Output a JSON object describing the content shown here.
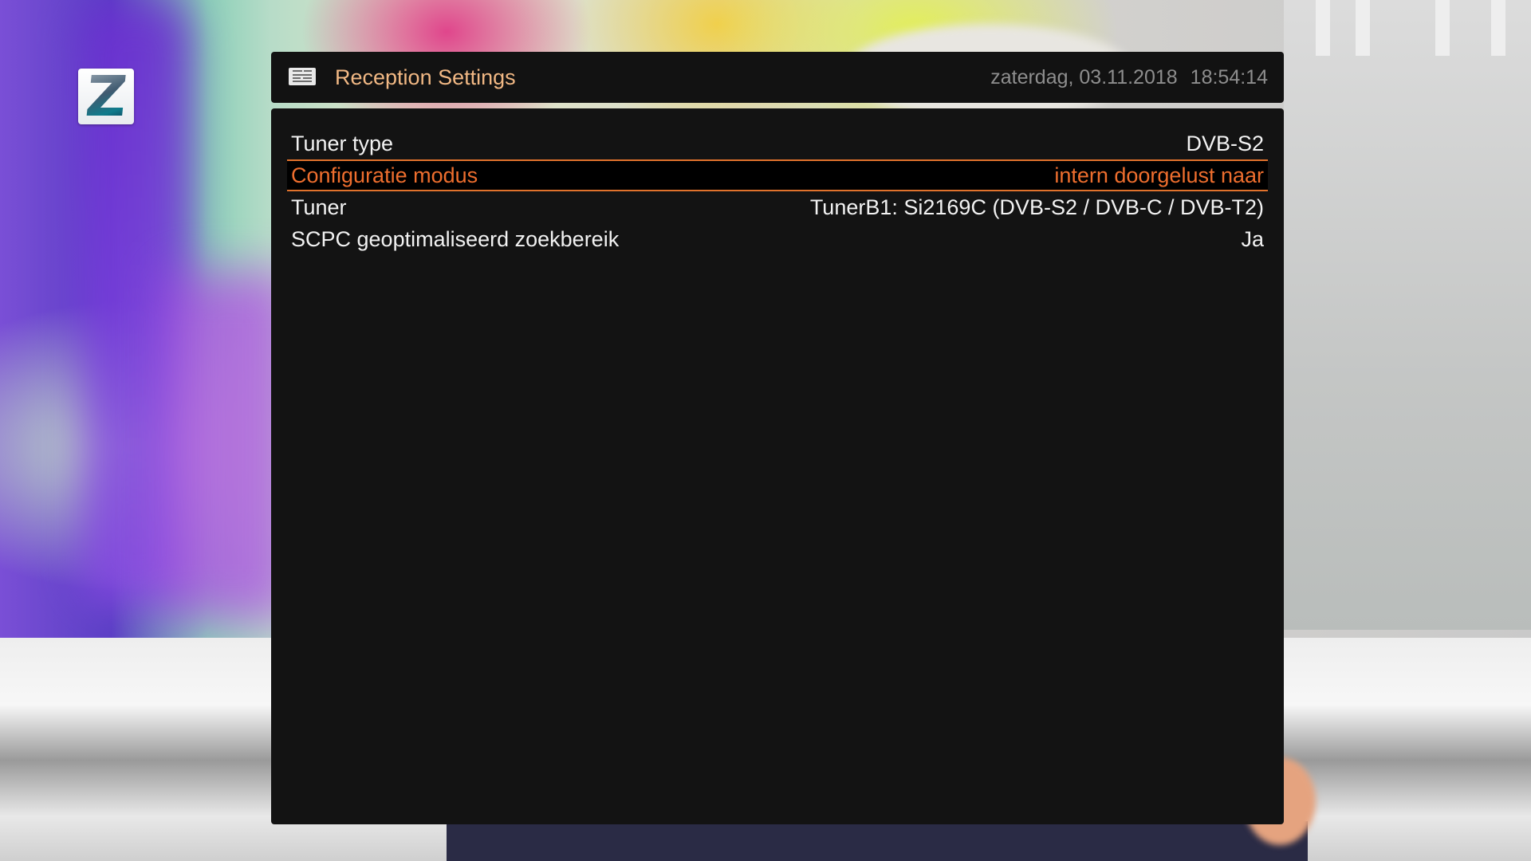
{
  "header": {
    "icon": "document-icon",
    "title": "Reception Settings",
    "date": "zaterdag, 03.11.2018",
    "time": "18:54:14"
  },
  "logo": {
    "letter": "Z"
  },
  "settings": [
    {
      "label": "Tuner type",
      "value": "DVB-S2",
      "selected": false
    },
    {
      "label": "Configuratie modus",
      "value": "intern doorgelust naar",
      "selected": true
    },
    {
      "label": "Tuner",
      "value": "TunerB1: Si2169C (DVB-S2 / DVB-C / DVB-T2)",
      "selected": false
    },
    {
      "label": "SCPC geoptimaliseerd zoekbereik",
      "value": "Ja",
      "selected": false
    }
  ],
  "colors": {
    "header_title": "#f1b884",
    "selection_accent": "#e0722c",
    "selected_text": "#ee6e2e",
    "panel_background": "#131313"
  }
}
